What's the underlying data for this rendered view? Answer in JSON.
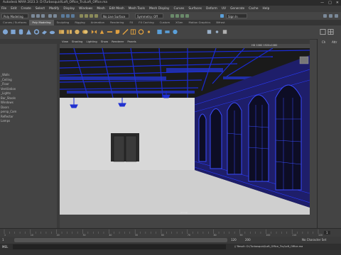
{
  "window": {
    "title": "Autodesk MAYA 2023.3: D:\\Turbosquid\\Loft_Office_Tru\\Loft_Office.ma",
    "controls": [
      "—",
      "□",
      "✕"
    ]
  },
  "menubar": {
    "items": [
      "File",
      "Edit",
      "Create",
      "Select",
      "Modify",
      "Display",
      "Windows",
      "Mesh",
      "Edit Mesh",
      "Mesh Tools",
      "Mesh Display",
      "Curves",
      "Surfaces",
      "Deform",
      "UV",
      "Generate",
      "Cache",
      "Help"
    ],
    "signin": "Sign In"
  },
  "statusline": {
    "workspace_label": "Poly Modeling",
    "surface_label": "No Live Surface",
    "symmetry_label": "Symmetry: Off"
  },
  "shelf_tabs": [
    "Curves / Surfaces",
    "Poly Modeling",
    "Sculpting",
    "Rigging",
    "Animation",
    "Rendering",
    "FX",
    "FX Caching",
    "Custom",
    "XGen",
    "Motion Graphics",
    "Bifrost"
  ],
  "active_shelf_tab": "Poly Modeling",
  "viewport": {
    "menu": [
      "View",
      "Shading",
      "Lighting",
      "Show",
      "Renderer",
      "Panels"
    ],
    "resolution_label": "HD 1080 1920x1080",
    "camera_label": "persp"
  },
  "outliner_items": [
    "_Walls",
    "_Ceiling",
    "_Floor",
    "Ventilation",
    "_Lights",
    "Bar_Stools",
    "Windows",
    "Doors",
    "persp_Cam",
    "Reflector",
    "Lamps"
  ],
  "right_panel": {
    "tab1": "Ch",
    "tab2": "Attr"
  },
  "timeline": {
    "ticks": [
      "1",
      "10",
      "20",
      "30",
      "40",
      "50",
      "60",
      "70",
      "80",
      "90",
      "100",
      "110",
      "120"
    ],
    "current_frame": "1"
  },
  "range": {
    "start": "1",
    "end": "120",
    "anim_start": "1",
    "anim_end": "200",
    "char_set": "No Character Set"
  },
  "cmdline": {
    "lang": "MEL",
    "result": "// Result: D:/Turbosquid/Loft_Office_Tru/Loft_Office.ma"
  },
  "colors": {
    "wire": "#1a2bd6",
    "highlight": "#2b3cff",
    "accent": "#5a9fd8"
  }
}
